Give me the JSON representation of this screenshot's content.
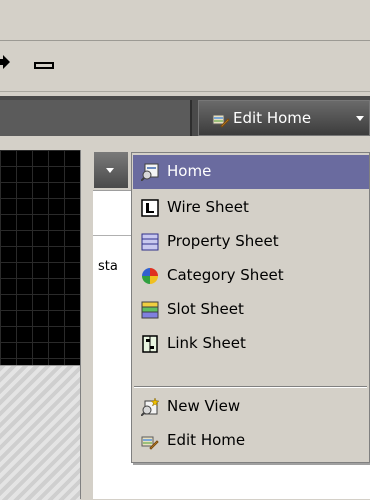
{
  "toolbar": {
    "edit_home_label": "Edit Home"
  },
  "side_panel": {
    "partial_text": "sta"
  },
  "menu": {
    "items": [
      {
        "label": "Home",
        "icon": "home-view-icon",
        "selected": true
      },
      {
        "label": "Wire Sheet",
        "icon": "wire-sheet-icon"
      },
      {
        "label": "Property Sheet",
        "icon": "property-sheet-icon"
      },
      {
        "label": "Category Sheet",
        "icon": "category-sheet-icon"
      },
      {
        "label": "Slot Sheet",
        "icon": "slot-sheet-icon"
      },
      {
        "label": "Link Sheet",
        "icon": "link-sheet-icon"
      },
      {
        "label": "New View",
        "icon": "new-view-icon"
      },
      {
        "label": "Edit Home",
        "icon": "edit-home-icon"
      }
    ]
  },
  "colors": {
    "selection": "#6a6b9f",
    "menu_bg": "#d4d0c8",
    "toolbar_dark": "#4a4a4a"
  }
}
